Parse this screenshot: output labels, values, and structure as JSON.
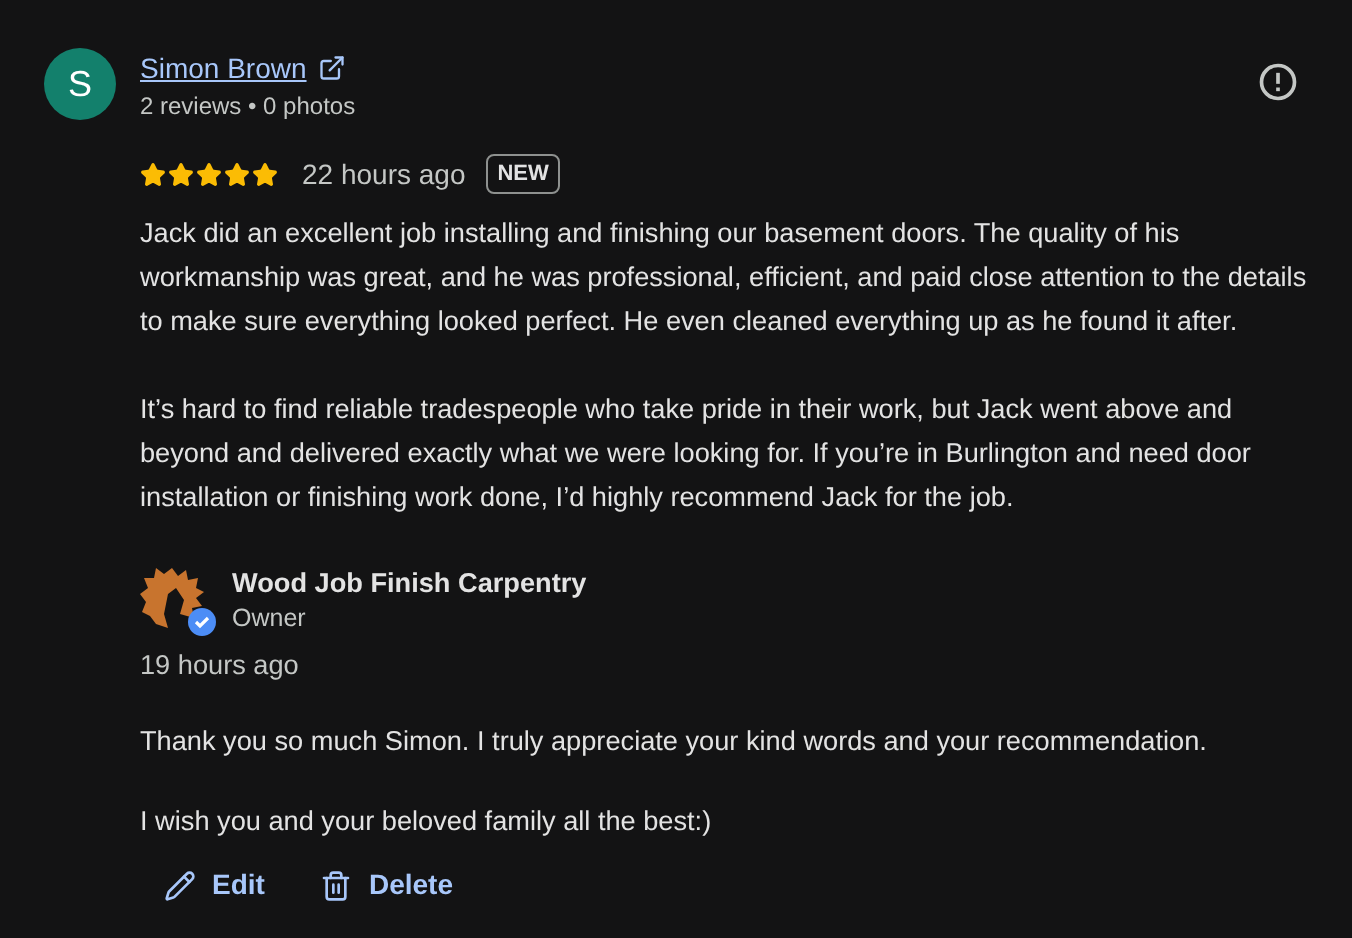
{
  "review": {
    "avatar_letter": "S",
    "author": "Simon Brown",
    "author_meta": "2 reviews • 0 photos",
    "stars": 5,
    "time": "22 hours ago",
    "badge": "NEW",
    "paragraphs": [
      "Jack did an excellent job installing and finishing our basement doors. The quality of his workmanship was great, and he was professional, efficient, and paid close attention to the details to make sure everything looked perfect. He even cleaned everything up as he found it after.",
      "It’s hard to find reliable tradespeople who take pride in their work, but Jack went above and beyond and delivered exactly what we were looking for. If you’re in Burlington and need door installation or finishing work done, I’d highly recommend Jack for the job."
    ]
  },
  "reply": {
    "owner_name": "Wood Job Finish Carpentry",
    "owner_role": "Owner",
    "verified": true,
    "time": "19 hours ago",
    "paragraphs": [
      "Thank you so much Simon. I truly appreciate your kind words and your recommendation.",
      "I wish you and your beloved family all the best:)"
    ]
  },
  "actions": [
    {
      "kind": "edit",
      "label": "Edit"
    },
    {
      "kind": "delete",
      "label": "Delete"
    }
  ]
}
